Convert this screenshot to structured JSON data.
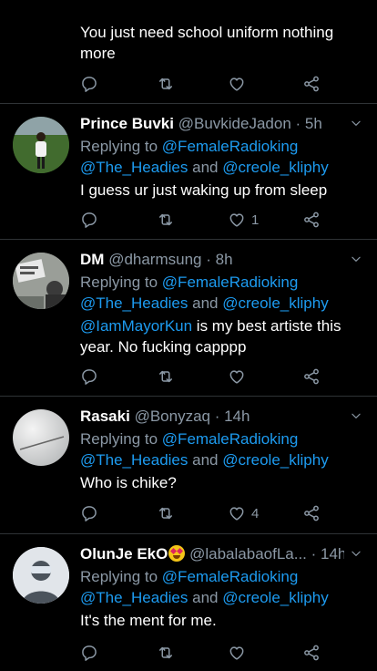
{
  "top_fragment": {
    "text": "You just need school uniform nothing more",
    "reply_count": "",
    "retweet_count": "",
    "like_count": ""
  },
  "tweets": [
    {
      "name": "Prince Buvki",
      "handle": "@BuvkideJadon",
      "time": "· 5h",
      "replying_prefix": "Replying to",
      "reply_to_1": "@FemaleRadioking",
      "reply_to_2": "@The_Headies",
      "and_word": "and",
      "reply_to_3": "@creole_kliphy",
      "text": "I guess ur just waking up from sleep",
      "like_count": "1"
    },
    {
      "name": "DM",
      "handle": "@dharmsung",
      "time": "· 8h",
      "replying_prefix": "Replying to",
      "reply_to_1": "@FemaleRadioking",
      "reply_to_2": "@The_Headies",
      "and_word": "and",
      "reply_to_3": "@creole_kliphy",
      "mention": "@IamMayorKun",
      "text": " is my best artiste this year. No fucking capppp",
      "like_count": ""
    },
    {
      "name": "Rasaki",
      "handle": "@Bonyzaq",
      "time": "· 14h",
      "replying_prefix": "Replying to",
      "reply_to_1": "@FemaleRadioking",
      "reply_to_2": "@The_Headies",
      "and_word": "and",
      "reply_to_3": "@creole_kliphy",
      "text": "Who is chike?",
      "like_count": "4"
    },
    {
      "name": "OlunJe EkO",
      "handle": "@labalabaofLa...",
      "time": "· 14h",
      "replying_prefix": "Replying to",
      "reply_to_1": "@FemaleRadioking",
      "reply_to_2": "@The_Headies",
      "and_word": "and",
      "reply_to_3": "@creole_kliphy",
      "text": "It's the ment for me.",
      "like_count": ""
    }
  ],
  "colors": {
    "background": "#000000",
    "link": "#1d9bf0",
    "secondary_text": "#8b98a5",
    "divider": "#2f3336"
  },
  "icons": [
    "reply-icon",
    "retweet-icon",
    "like-icon",
    "share-icon",
    "caret-down-icon",
    "emoji-icon"
  ]
}
